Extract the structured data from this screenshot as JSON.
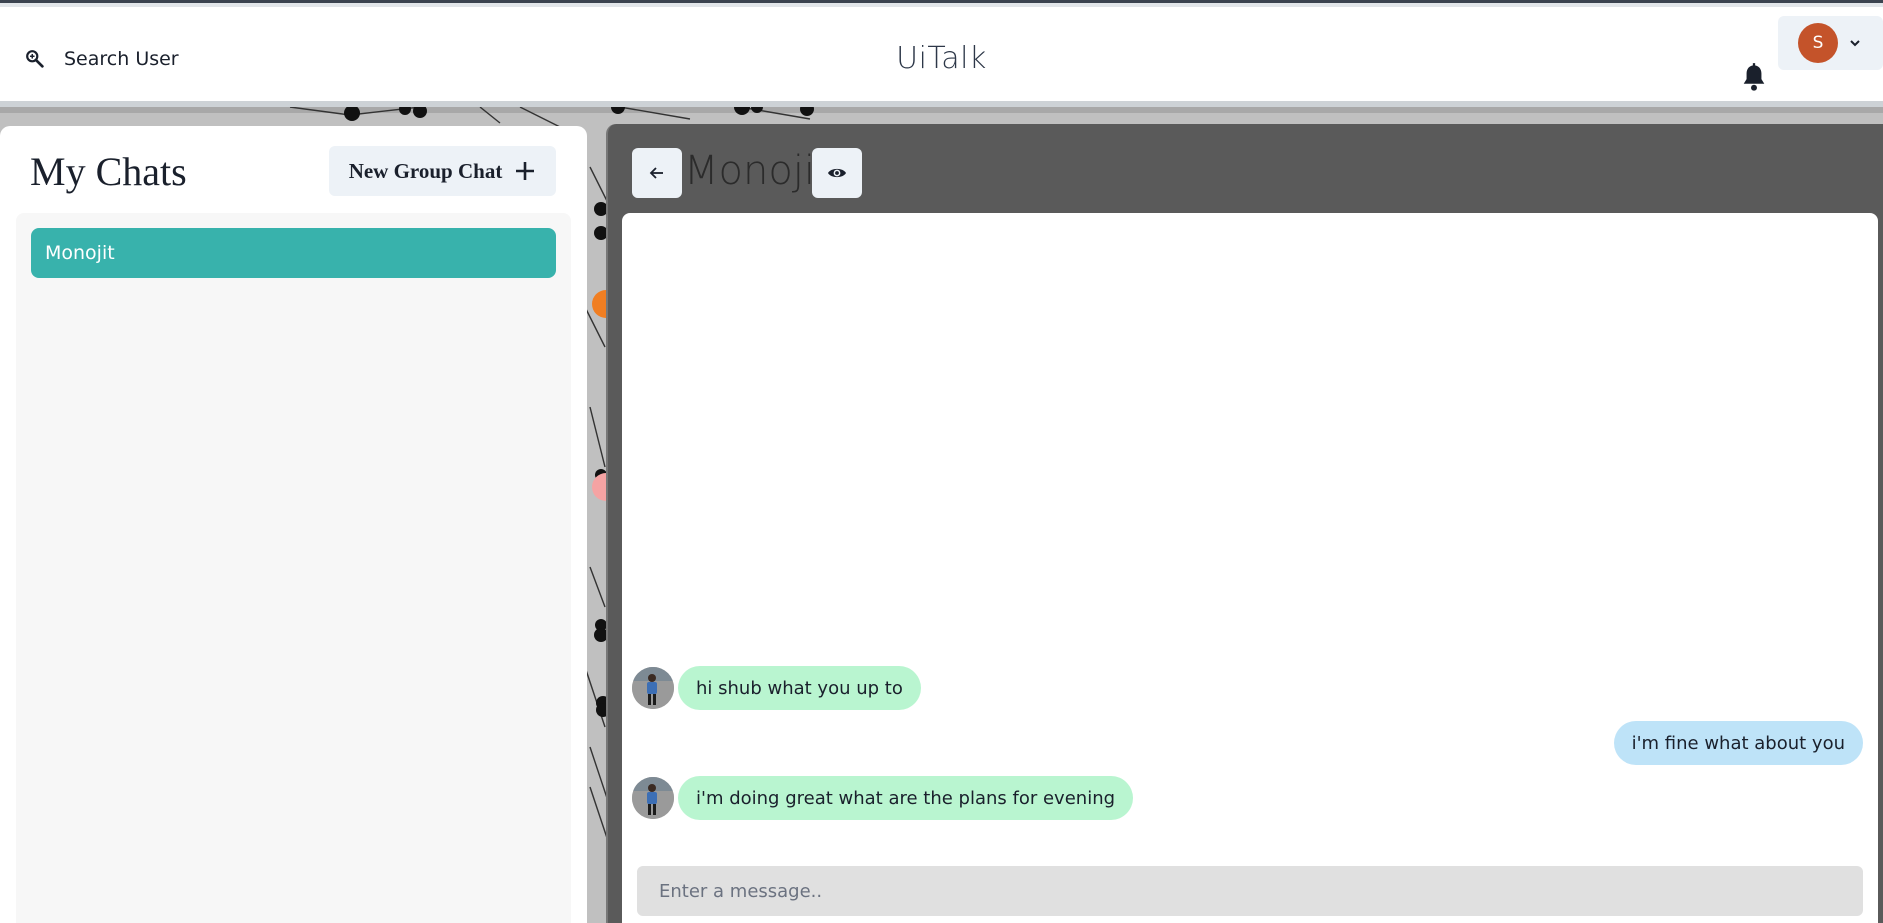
{
  "header": {
    "search_label": "Search User",
    "brand": "UiTalk",
    "profile_initial": "S"
  },
  "sidebar": {
    "title": "My Chats",
    "new_group_label": "New Group Chat",
    "chats": [
      {
        "name": "Monojit",
        "selected": true
      }
    ]
  },
  "chat": {
    "name": "Monojit",
    "messages": [
      {
        "text": "hi shub what you up to",
        "direction": "received",
        "show_avatar": true
      },
      {
        "text": "i'm fine what about you",
        "direction": "sent",
        "show_avatar": false
      },
      {
        "text": "i'm doing great what are the plans for evening",
        "direction": "received",
        "show_avatar": true
      }
    ],
    "input_placeholder": "Enter a message.."
  },
  "colors": {
    "selected_chat": "#38b2ac",
    "received_bubble": "#b9f5d0",
    "sent_bubble": "#bee3f8",
    "avatar_bg": "#c4532a",
    "chat_panel_bg": "#5a5a5a"
  },
  "icons": {
    "search": "search-icon",
    "bell": "bell-icon",
    "chevron": "chevron-down-icon",
    "plus": "plus-icon",
    "back": "arrow-left-icon",
    "eye": "eye-icon"
  }
}
